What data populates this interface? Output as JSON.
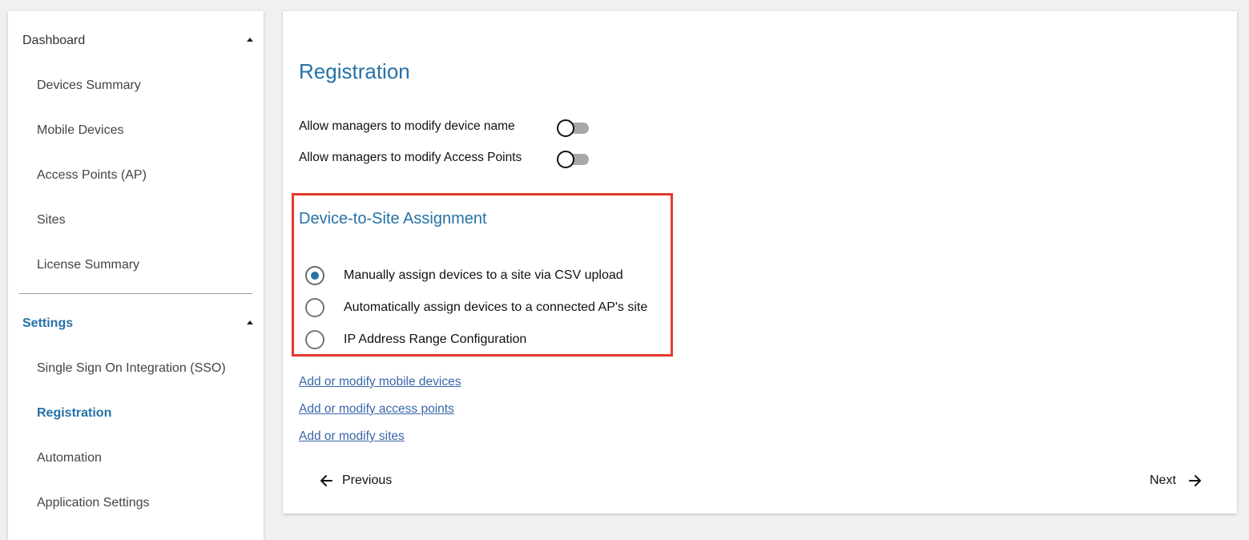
{
  "sidebar": {
    "dashboard": {
      "label": "Dashboard",
      "items": [
        {
          "label": "Devices Summary"
        },
        {
          "label": "Mobile Devices"
        },
        {
          "label": "Access Points (AP)"
        },
        {
          "label": "Sites"
        },
        {
          "label": "License Summary"
        }
      ]
    },
    "settings": {
      "label": "Settings",
      "items": [
        {
          "label": "Single Sign On Integration (SSO)"
        },
        {
          "label": "Registration"
        },
        {
          "label": "Automation"
        },
        {
          "label": "Application Settings"
        }
      ]
    }
  },
  "main": {
    "title": "Registration",
    "toggles": [
      {
        "label": "Allow managers to modify device name",
        "on": false
      },
      {
        "label": "Allow managers to modify Access Points",
        "on": false
      }
    ],
    "assignment": {
      "title": "Device-to-Site Assignment",
      "options": [
        {
          "label": "Manually assign devices to a site via CSV upload",
          "selected": true
        },
        {
          "label": "Automatically assign devices to a connected AP's site",
          "selected": false
        },
        {
          "label": "IP Address Range Configuration",
          "selected": false
        }
      ]
    },
    "links": [
      {
        "label": "Add or modify mobile devices"
      },
      {
        "label": "Add or modify access points"
      },
      {
        "label": "Add or modify sites"
      }
    ],
    "nav": {
      "previous_label": "Previous",
      "next_label": "Next"
    }
  },
  "colors": {
    "accent": "#2671a6",
    "highlight": "#e53a2c",
    "link": "#3a66a8"
  }
}
